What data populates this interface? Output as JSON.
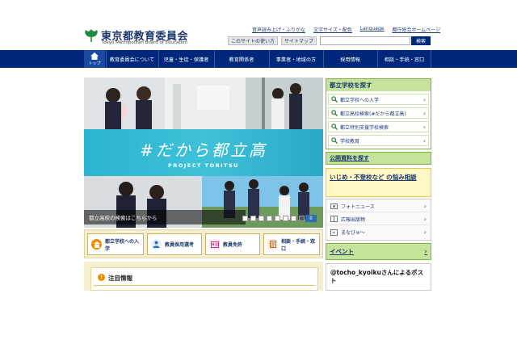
{
  "header": {
    "logo_jp": "東京都教育委員会",
    "logo_en": "Tokyo Metropolitan Board of Education",
    "util_links": [
      "音声読み上げ・ふりがな",
      "文字サイズ・配色",
      "Language",
      "都庁総合ホームページ"
    ],
    "usage_label": "このサイトの使い方",
    "sitemap_label": "サイトマップ",
    "search_placeholder": "",
    "search_button": "検索"
  },
  "nav": {
    "home_label": "トップ",
    "items": [
      "教育委員会について",
      "児童・生徒・保護者",
      "教育関係者",
      "事業者・地域の方",
      "採用情報",
      "相談・手続・窓口"
    ]
  },
  "hero": {
    "logo_text": "#だから都立高",
    "sub_text": "PROJECT TORITSU",
    "caption": "都立高校の検索はこちらから",
    "slide_count": 8,
    "active_slide": 8,
    "pause_label": "II"
  },
  "quick_links": [
    "都立学校への入学",
    "教員採用選考",
    "教員免許",
    "相談・手続・窓口"
  ],
  "notice": {
    "title": "注目情報"
  },
  "sidebar": {
    "school_search": {
      "heading": "都立学校を探す",
      "items": [
        "都立学校への入学",
        "都立高校検索(#だから都立高)",
        "都立特別支援学校検索",
        "学校教育"
      ]
    },
    "public_docs": "公開資料を探す",
    "bullying": "いじめ・不登校など の悩み相談",
    "links": [
      "フォトニュース",
      "広報出版物",
      "まなびゅ～"
    ],
    "event": "イベント",
    "x_posts": "@tocho_kyoikuさんによるポスト"
  },
  "colors": {
    "nav_bg": "#00287a",
    "accent_green": "#c5e39a",
    "hero_band": "#3fc1d8",
    "quick_bg": "#f5efd0",
    "notice_icon": "#f08c00"
  }
}
